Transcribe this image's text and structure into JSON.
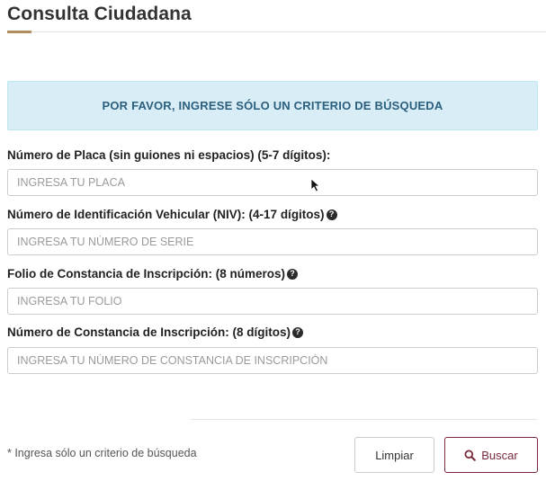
{
  "page": {
    "title": "Consulta Ciudadana"
  },
  "alert": {
    "text": "POR FAVOR, INGRESE SÓLO UN CRITERIO DE BÚSQUEDA"
  },
  "fields": [
    {
      "label": "Número de Placa (sin guiones ni espacios) (5-7 dígitos):",
      "placeholder": "INGRESA TU PLACA",
      "value": "",
      "has_help": false
    },
    {
      "label": "Número de Identificación Vehicular (NIV): (4-17 dígitos)",
      "placeholder": "INGRESA TU NÚMERO DE SERIE",
      "value": "",
      "has_help": true
    },
    {
      "label": "Folio de Constancia de Inscripción: (8 números)",
      "placeholder": "INGRESA TU FOLIO",
      "value": "",
      "has_help": true
    },
    {
      "label": "Número de Constancia de Inscripción: (8 dígitos)",
      "placeholder": "INGRESA TU NÚMERO DE CONSTANCIA DE INSCRIPCIÓN",
      "value": "",
      "has_help": true
    }
  ],
  "help_icon_glyph": "?",
  "footer": {
    "note": "* Ingresa sólo un criterio de búsqueda",
    "clear_label": "Limpiar",
    "search_label": "Buscar"
  },
  "colors": {
    "accent": "#b38e5d",
    "alert_bg": "#d9edf7",
    "alert_text": "#2a5f7e",
    "primary_button": "#7a2a3a"
  },
  "icons": {
    "help": "question-circle-icon",
    "search": "magnifier-icon",
    "cursor": "mouse-pointer-icon"
  }
}
